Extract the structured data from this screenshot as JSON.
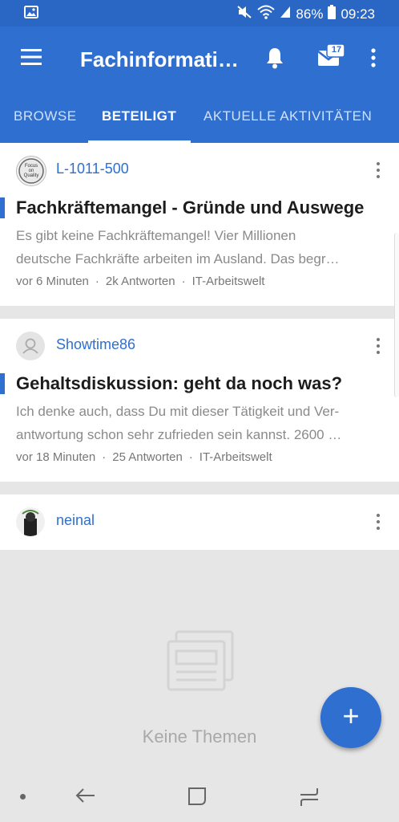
{
  "status_bar": {
    "battery": "86%",
    "time": "09:23"
  },
  "app_bar": {
    "title": "Fachinformati…",
    "mail_badge": "17"
  },
  "tabs": [
    {
      "label": "BROWSE"
    },
    {
      "label": "BETEILIGT"
    },
    {
      "label": "AKTUELLE AKTIVITÄTEN"
    }
  ],
  "threads": [
    {
      "author": "L-1011-500",
      "title": "Fachkräftemangel - Gründe und Auswege",
      "excerpt_line1": "Es gibt keine Fachkräftemangel! Vier Millionen",
      "excerpt_line2": "deutsche Fachkräfte arbeiten im Ausland. Das begr…",
      "time": "vor 6 Minuten",
      "replies": "2k Antworten",
      "forum": "IT-Arbeitswelt"
    },
    {
      "author": "Showtime86",
      "title": "Gehaltsdiskussion: geht da noch was?",
      "excerpt_line1": "Ich denke auch, dass Du mit dieser Tätigkeit und Ver-",
      "excerpt_line2": "antwortung schon sehr zufrieden sein kannst. 2600 …",
      "time": "vor 18 Minuten",
      "replies": "25 Antworten",
      "forum": "IT-Arbeitswelt"
    },
    {
      "author": "neinal"
    }
  ],
  "avatar_logo": {
    "line1": "Focus",
    "line2": "on",
    "line3": "Quality"
  },
  "empty_state": {
    "text": "Keine Themen"
  },
  "fab": {
    "label": "+"
  },
  "colors": {
    "primary": "#2f6fd0",
    "status_bar": "#2a66c4",
    "background": "#e6e6e6"
  }
}
